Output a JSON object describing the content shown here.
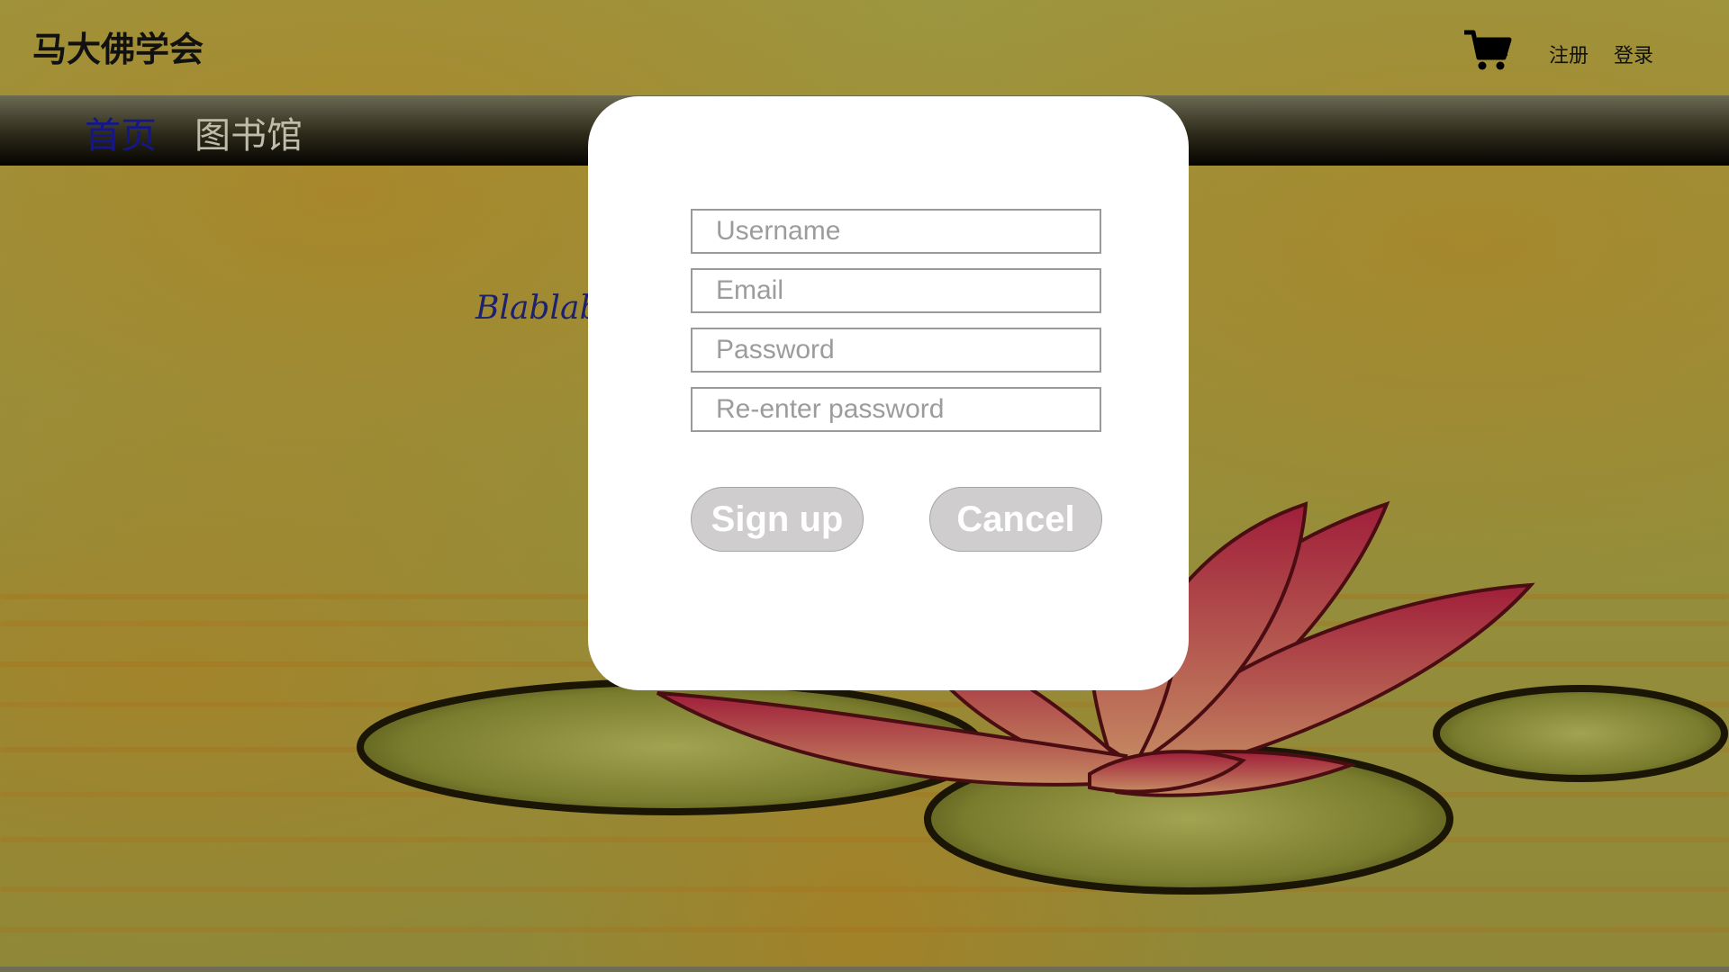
{
  "header": {
    "site_title": "马大佛学会",
    "cart_icon": "shopping-cart-icon",
    "links": [
      "注册",
      "登录"
    ]
  },
  "nav": {
    "items": [
      {
        "label": "首页",
        "active": true,
        "color": "#14168a"
      },
      {
        "label": "图书馆",
        "active": false,
        "color": "#bfbcaa"
      }
    ]
  },
  "main": {
    "text": "Blablab"
  },
  "signup_modal": {
    "fields": [
      {
        "placeholder": "Username"
      },
      {
        "placeholder": "Email"
      },
      {
        "placeholder": "Password"
      },
      {
        "placeholder": "Re-enter password"
      }
    ],
    "signup_label": "Sign up",
    "cancel_label": "Cancel"
  },
  "colors": {
    "background": "#8f8a3a",
    "ornament": "#b8781a",
    "navbar": "#050401",
    "modal": "#ffffff",
    "button": "#cfcdcd"
  }
}
